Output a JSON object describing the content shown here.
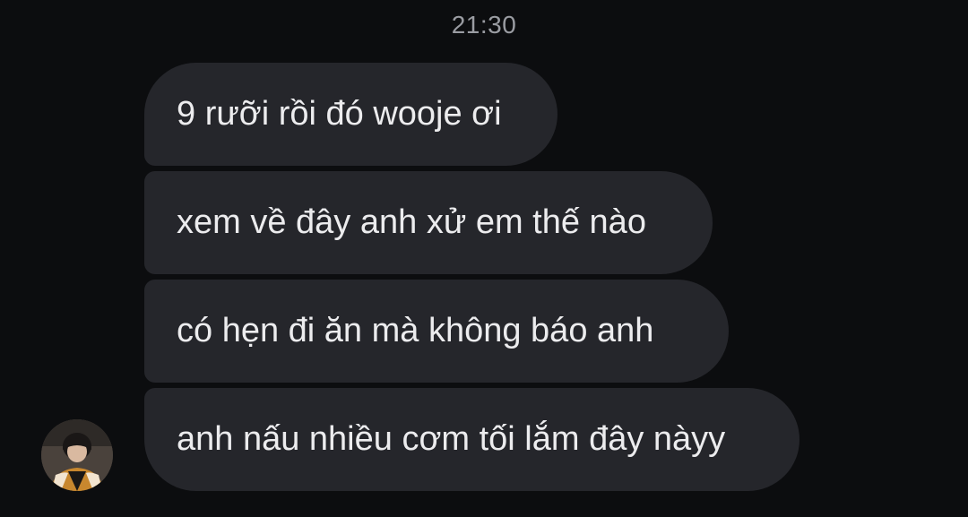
{
  "timestamp": "21:30",
  "messages": [
    {
      "text": "9 rưỡi rồi đó wooje ơi"
    },
    {
      "text": "xem về đây anh xử em thế nào"
    },
    {
      "text": "có hẹn đi ăn mà không báo anh"
    },
    {
      "text": "anh nấu nhiều cơm tối lắm đây nàyy"
    }
  ],
  "sender": {
    "avatar_icon": "profile-photo-avatar"
  },
  "colors": {
    "background": "#0c0d0f",
    "bubble": "#25262b",
    "bubble_text": "#ececee",
    "timestamp": "#9a9ca2"
  }
}
